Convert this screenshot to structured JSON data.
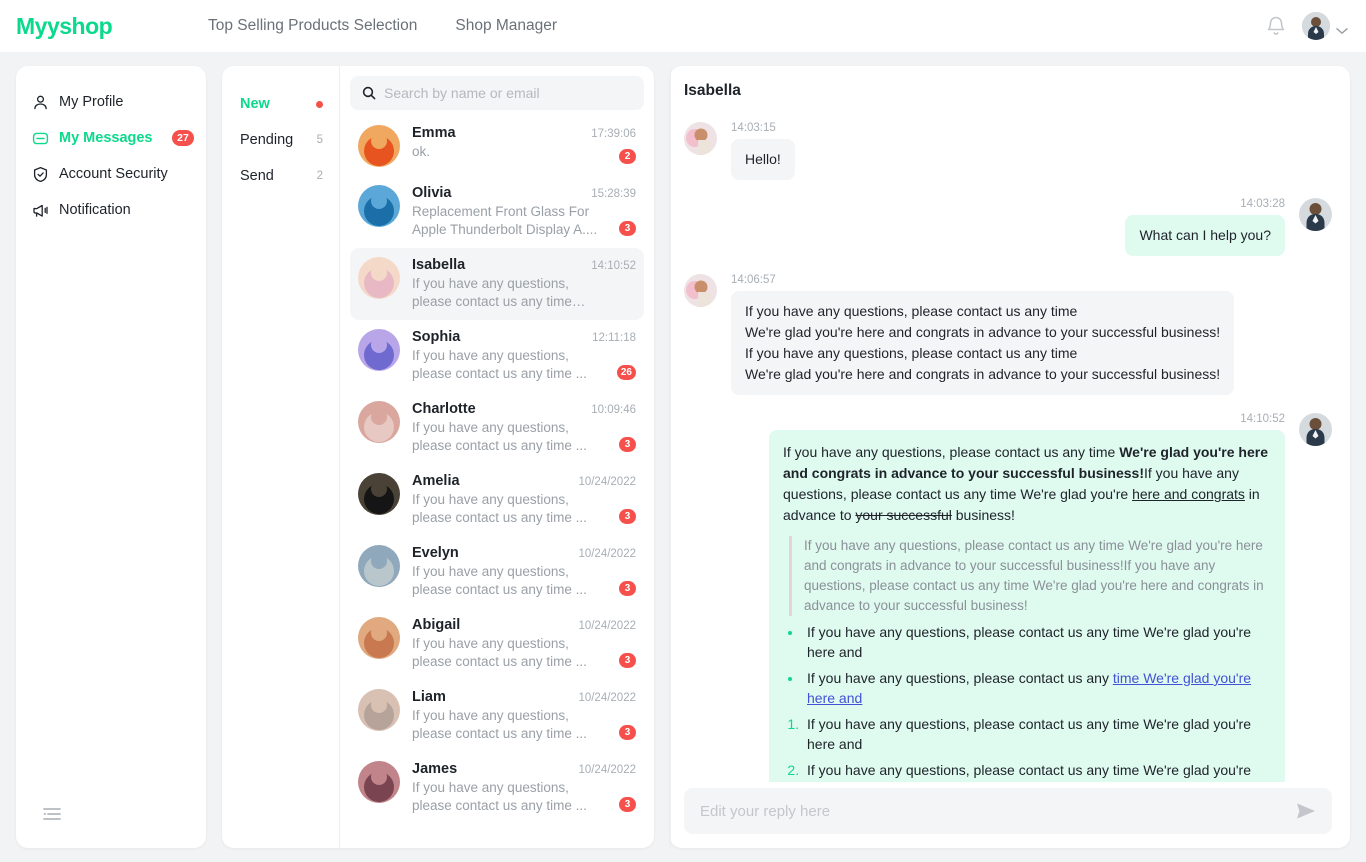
{
  "brand": "Myyshop",
  "topnav": [
    {
      "label": "Top Selling Products Selection"
    },
    {
      "label": "Shop Manager"
    }
  ],
  "icons": {
    "bell": "bell-icon",
    "chevron": "chevron-down-icon",
    "search": "search-icon",
    "send": "send-icon",
    "collapse": "collapse-sidebar-icon"
  },
  "colors": {
    "accent": "#0bd98b",
    "badge": "#f5504c",
    "bubble_out": "#dffaef",
    "bubble_in": "#f4f5f6",
    "link": "#4252d6",
    "page_bg": "#f2f3f5"
  },
  "sidebar": {
    "items": [
      {
        "label": "My Profile",
        "icon": "user-icon",
        "active": false,
        "badge": ""
      },
      {
        "label": "My Messages",
        "icon": "message-icon",
        "active": true,
        "badge": "27"
      },
      {
        "label": "Account Security",
        "icon": "shield-check-icon",
        "active": false,
        "badge": ""
      },
      {
        "label": "Notification",
        "icon": "megaphone-icon",
        "active": false,
        "badge": ""
      }
    ]
  },
  "folders": [
    {
      "label": "New",
      "count": "",
      "dot": true,
      "active": true
    },
    {
      "label": "Pending",
      "count": "5",
      "dot": false,
      "active": false
    },
    {
      "label": "Send",
      "count": "2",
      "dot": false,
      "active": false
    }
  ],
  "search": {
    "placeholder": "Search by name or email",
    "value": ""
  },
  "conversations": [
    {
      "name": "Emma",
      "time": "17:39:06",
      "preview": "ok.",
      "badge": "2",
      "selected": false,
      "c1": "#e8541f",
      "c2": "#f0a860"
    },
    {
      "name": "Olivia",
      "time": "15:28:39",
      "preview": "Replacement Front Glass For Apple Thunderbolt Display A....",
      "badge": "3",
      "selected": false,
      "c1": "#1b6fa8",
      "c2": "#5ba8d8"
    },
    {
      "name": "Isabella",
      "time": "14:10:52",
      "preview": "If you have any questions, please contact us any time We're glad yo...",
      "badge": "",
      "selected": true,
      "c1": "#e8b9c4",
      "c2": "#f4d9c9"
    },
    {
      "name": "Sophia",
      "time": "12:11:18",
      "preview": "If you have any questions, please contact us any time ...",
      "badge": "26",
      "selected": false,
      "c1": "#6f6ad0",
      "c2": "#b9a6e8"
    },
    {
      "name": "Charlotte",
      "time": "10:09:46",
      "preview": "If you have any questions, please contact us any time ...",
      "badge": "3",
      "selected": false,
      "c1": "#e7c8c2",
      "c2": "#d9a79e"
    },
    {
      "name": "Amelia",
      "time": "10/24/2022",
      "preview": "If you have any questions, please contact us any time ...",
      "badge": "3",
      "selected": false,
      "c1": "#151515",
      "c2": "#4a4236"
    },
    {
      "name": "Evelyn",
      "time": "10/24/2022",
      "preview": "If you have any questions, please contact us any time ...",
      "badge": "3",
      "selected": false,
      "c1": "#b9c6cc",
      "c2": "#8fa8bb"
    },
    {
      "name": "Abigail",
      "time": "10/24/2022",
      "preview": "If you have any questions, please contact us any time ...",
      "badge": "3",
      "selected": false,
      "c1": "#c9794f",
      "c2": "#e0a97f"
    },
    {
      "name": "Liam",
      "time": "10/24/2022",
      "preview": "If you have any questions, please contact us any time ...",
      "badge": "3",
      "selected": false,
      "c1": "#b6a49a",
      "c2": "#d8c0b2"
    },
    {
      "name": "James",
      "time": "10/24/2022",
      "preview": "If you have any questions, please contact us any time ...",
      "badge": "3",
      "selected": false,
      "c1": "#7a4550",
      "c2": "#c0848a"
    }
  ],
  "chat": {
    "title": "Isabella",
    "messages": [
      {
        "side": "in",
        "time": "14:03:15",
        "text": "Hello!"
      },
      {
        "side": "out",
        "time": "14:03:28",
        "text": "What can I help you?"
      },
      {
        "side": "in",
        "time": "14:06:57",
        "text": "If you have any questions, please contact us any time\nWe're glad you're here and congrats in advance to your successful business!\nIf you have any questions, please contact us any time\nWe're glad you're here and congrats in advance to your successful business!"
      }
    ],
    "rich_message": {
      "side": "out",
      "time": "14:10:52",
      "paragraph": {
        "plain_1": "If you have any questions, please contact us any time ",
        "bold": "We're glad you're here and congrats in advance to your successful business!",
        "plain_2": "If you have any questions, please contact us any time We're glad you're ",
        "underline": "here and congrats",
        "plain_3": " in advance to ",
        "strike": "your successful",
        "plain_4": " business!"
      },
      "quote": "If you have any questions, please contact us any time We're glad you're here and congrats in advance to your successful business!If you have any questions, please contact us any time We're glad you're here and congrats in advance to your successful business!",
      "bullets": [
        {
          "text": "If you have any questions, please contact us any time We're glad you're here and",
          "link_before": "",
          "link": "",
          "link_after": ""
        },
        {
          "text": "",
          "link_before": "If you have any questions, please contact us any ",
          "link": "time We're glad you're here and",
          "link_after": ""
        }
      ],
      "numbered": [
        "If you have any questions, please contact us any time We're glad you're here and",
        "If you have any questions, please contact us any time We're glad you're here and"
      ]
    },
    "composer": {
      "placeholder": "Edit your reply here",
      "value": ""
    }
  }
}
